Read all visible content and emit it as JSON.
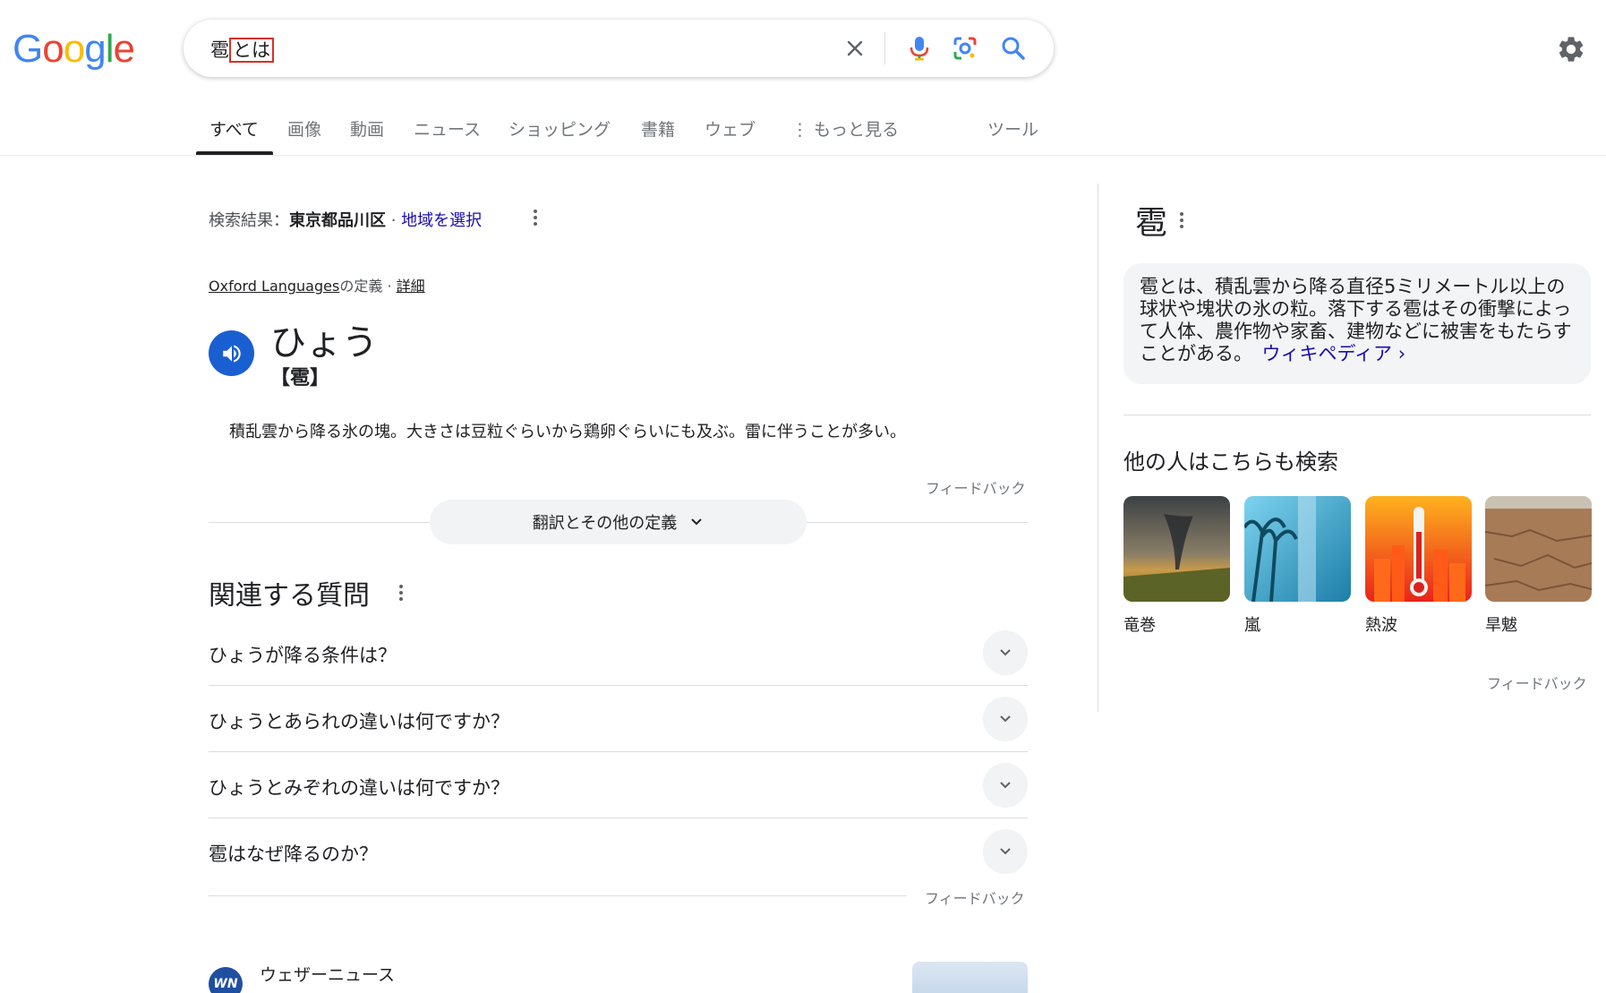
{
  "logo": {
    "text": "Google",
    "letters": [
      {
        "ch": "G",
        "color": "#4285F4"
      },
      {
        "ch": "o",
        "color": "#EA4335"
      },
      {
        "ch": "o",
        "color": "#FBBC05"
      },
      {
        "ch": "g",
        "color": "#4285F4"
      },
      {
        "ch": "l",
        "color": "#34A853"
      },
      {
        "ch": "e",
        "color": "#EA4335"
      }
    ]
  },
  "search": {
    "query_prefix": "雹",
    "query_highlight": "とは"
  },
  "tabs": [
    {
      "label": "すべて",
      "active": true
    },
    {
      "label": "画像"
    },
    {
      "label": "動画"
    },
    {
      "label": "ニュース"
    },
    {
      "label": "ショッピング"
    },
    {
      "label": "書籍"
    },
    {
      "label": "ウェブ"
    },
    {
      "label": "もっと見る"
    },
    {
      "label": "ツール"
    }
  ],
  "location": {
    "prefix": "検索結果：",
    "place": "東京都品川区",
    "sep": " · ",
    "link": "地域を選択"
  },
  "dictionary": {
    "source": "Oxford Languages",
    "source_suffix": "の定義 · ",
    "details": "詳細",
    "word": "ひょう",
    "kanji": "【雹】",
    "definition": "積乱雲から降る氷の塊。大きさは豆粒ぐらいから鶏卵ぐらいにも及ぶ。雷に伴うことが多い。",
    "feedback": "フィードバック",
    "more_button": "翻訳とその他の定義"
  },
  "paa": {
    "title": "関連する質問",
    "questions": [
      "ひょうが降る条件は？",
      "ひょうとあられの違いは何ですか？",
      "ひょうとみぞれの違いは何ですか？",
      "雹はなぜ降るのか？"
    ],
    "feedback": "フィードバック"
  },
  "news": {
    "source": "ウェザーニュース",
    "logo_text": "WN"
  },
  "knowledge_panel": {
    "title": "雹",
    "description": "雹とは、積乱雲から降る直径5ミリメートル以上の球状や塊状の氷の粒。落下する雹はその衝撃によって人体、農作物や家畜、建物などに被害をもたらすことがある。",
    "wiki_link": "ウィキペディア ›",
    "also_title": "他の人はこちらも検索",
    "also": [
      "竜巻",
      "嵐",
      "熱波",
      "旱魃"
    ],
    "feedback": "フィードバック"
  },
  "colors": {
    "accent": "#1a5fd1",
    "link": "#1a0dab",
    "highlight_box": "#d93025"
  }
}
